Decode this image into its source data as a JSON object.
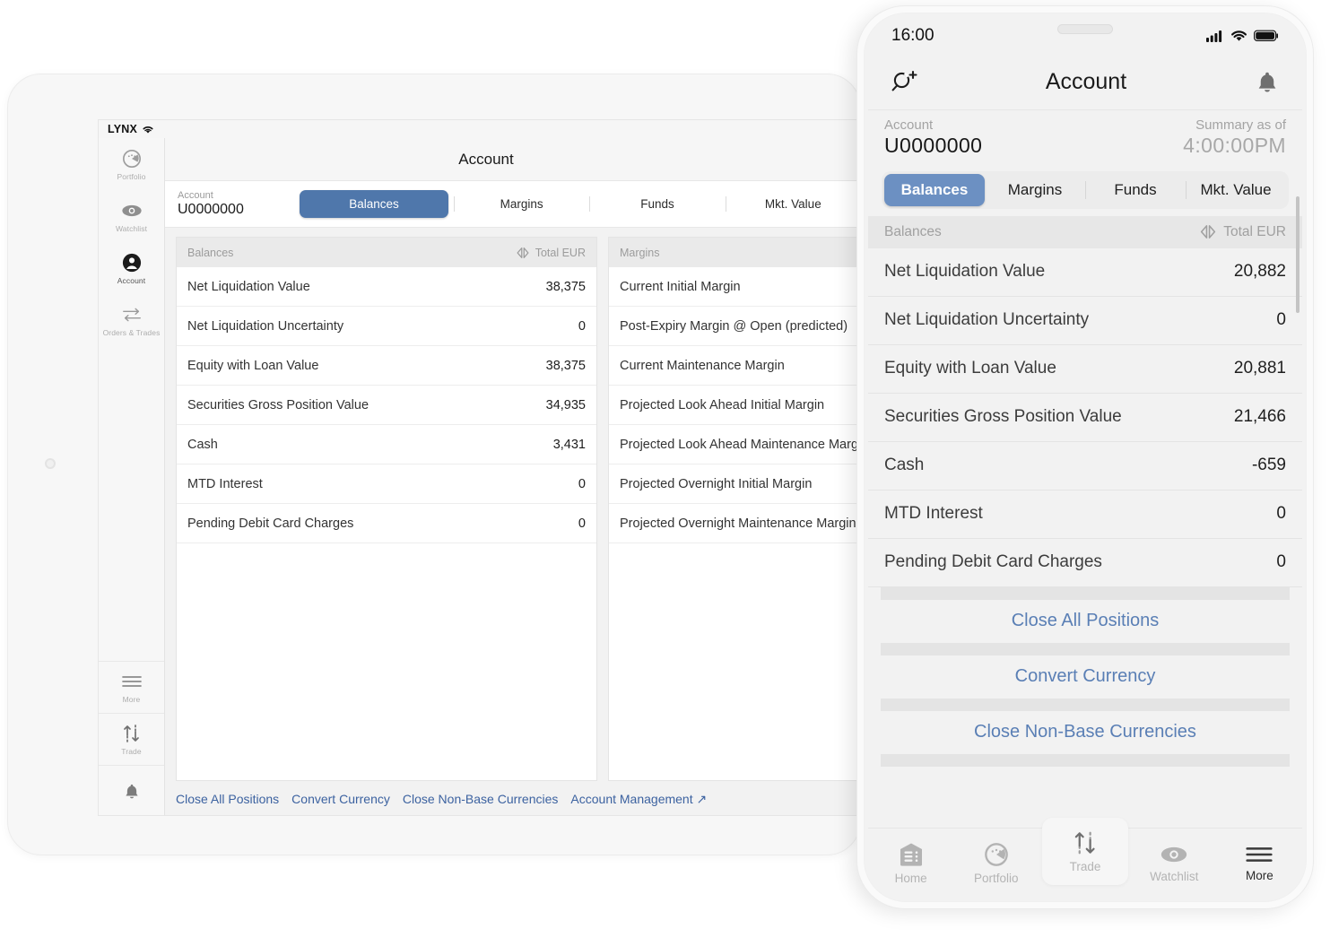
{
  "tablet": {
    "status_bar": {
      "brand": "LYNX",
      "wifi_icon": "wifi-icon"
    },
    "sidebar": [
      {
        "label": "Portfolio",
        "icon": "portfolio-icon",
        "active": false
      },
      {
        "label": "Watchlist",
        "icon": "eye-icon",
        "active": false
      },
      {
        "label": "Account",
        "icon": "person-icon",
        "active": true
      },
      {
        "label": "Orders & Trades",
        "icon": "arrows-icon",
        "active": false
      },
      {
        "label": "More",
        "icon": "hamburger-icon",
        "active": false
      },
      {
        "label": "Trade",
        "icon": "trade-arrows-icon",
        "active": false
      }
    ],
    "bell_icon": "bell-icon",
    "title": "Account",
    "account": {
      "label": "Account",
      "value": "U0000000"
    },
    "tabs": [
      {
        "label": "Balances",
        "active": true
      },
      {
        "label": "Margins",
        "active": false
      },
      {
        "label": "Funds",
        "active": false
      },
      {
        "label": "Mkt. Value",
        "active": false
      }
    ],
    "balances_panel": {
      "header": "Balances",
      "currency_icon": "currency-switch-icon",
      "currency": "Total EUR",
      "rows": [
        {
          "label": "Net Liquidation Value",
          "value": "38,375"
        },
        {
          "label": "Net Liquidation Uncertainty",
          "value": "0"
        },
        {
          "label": "Equity with Loan Value",
          "value": "38,375"
        },
        {
          "label": "Securities Gross Position Value",
          "value": "34,935"
        },
        {
          "label": "Cash",
          "value": "3,431"
        },
        {
          "label": "MTD Interest",
          "value": "0"
        },
        {
          "label": "Pending Debit Card Charges",
          "value": "0"
        }
      ]
    },
    "margins_panel": {
      "header": "Margins",
      "rows": [
        {
          "label": "Current Initial Margin",
          "value": ""
        },
        {
          "label": "Post-Expiry Margin @ Open (predicted)",
          "value": ""
        },
        {
          "label": "Current Maintenance Margin",
          "value": ""
        },
        {
          "label": "Projected Look Ahead Initial Margin",
          "value": ""
        },
        {
          "label": "Projected Look Ahead Maintenance Margin",
          "value": ""
        },
        {
          "label": "Projected Overnight Initial Margin",
          "value": ""
        },
        {
          "label": "Projected Overnight Maintenance Margin",
          "value": ""
        }
      ]
    },
    "footer_links": [
      "Close All Positions",
      "Convert Currency",
      "Close Non-Base Currencies",
      "Account Management ↗"
    ]
  },
  "phone": {
    "status_bar": {
      "time": "16:00",
      "signal_icon": "cellular-signal-icon",
      "wifi_icon": "wifi-icon",
      "battery_icon": "battery-icon"
    },
    "nav": {
      "search_icon": "search-add-icon",
      "title": "Account",
      "bell_icon": "bell-icon"
    },
    "account": {
      "label": "Account",
      "value": "U0000000",
      "summary_label": "Summary as of",
      "summary_time": "4:00:00PM"
    },
    "tabs": [
      {
        "label": "Balances",
        "active": true
      },
      {
        "label": "Margins",
        "active": false
      },
      {
        "label": "Funds",
        "active": false
      },
      {
        "label": "Mkt. Value",
        "active": false
      }
    ],
    "subhead": {
      "title": "Balances",
      "currency_icon": "currency-switch-icon",
      "currency": "Total EUR"
    },
    "rows": [
      {
        "label": "Net Liquidation Value",
        "value": "20,882"
      },
      {
        "label": "Net Liquidation Uncertainty",
        "value": "0"
      },
      {
        "label": "Equity with Loan Value",
        "value": "20,881"
      },
      {
        "label": "Securities Gross Position Value",
        "value": "21,466"
      },
      {
        "label": "Cash",
        "value": "-659"
      },
      {
        "label": "MTD Interest",
        "value": "0"
      },
      {
        "label": "Pending Debit Card Charges",
        "value": "0"
      }
    ],
    "actions": [
      "Close All Positions",
      "Convert Currency",
      "Close Non-Base Currencies"
    ],
    "tabbar": [
      {
        "label": "Home",
        "icon": "home-icon",
        "active": false,
        "raised": false
      },
      {
        "label": "Portfolio",
        "icon": "portfolio-icon",
        "active": false,
        "raised": false
      },
      {
        "label": "Trade",
        "icon": "trade-arrows-icon",
        "active": false,
        "raised": true
      },
      {
        "label": "Watchlist",
        "icon": "eye-icon",
        "active": false,
        "raised": false
      },
      {
        "label": "More",
        "icon": "hamburger-icon",
        "active": true,
        "raised": false
      }
    ]
  },
  "colors": {
    "accent_blue": "#4f77ab",
    "phone_accent_blue": "#6c90c2",
    "link_blue": "#3c62a0",
    "phone_link_blue": "#5a7fb5"
  }
}
